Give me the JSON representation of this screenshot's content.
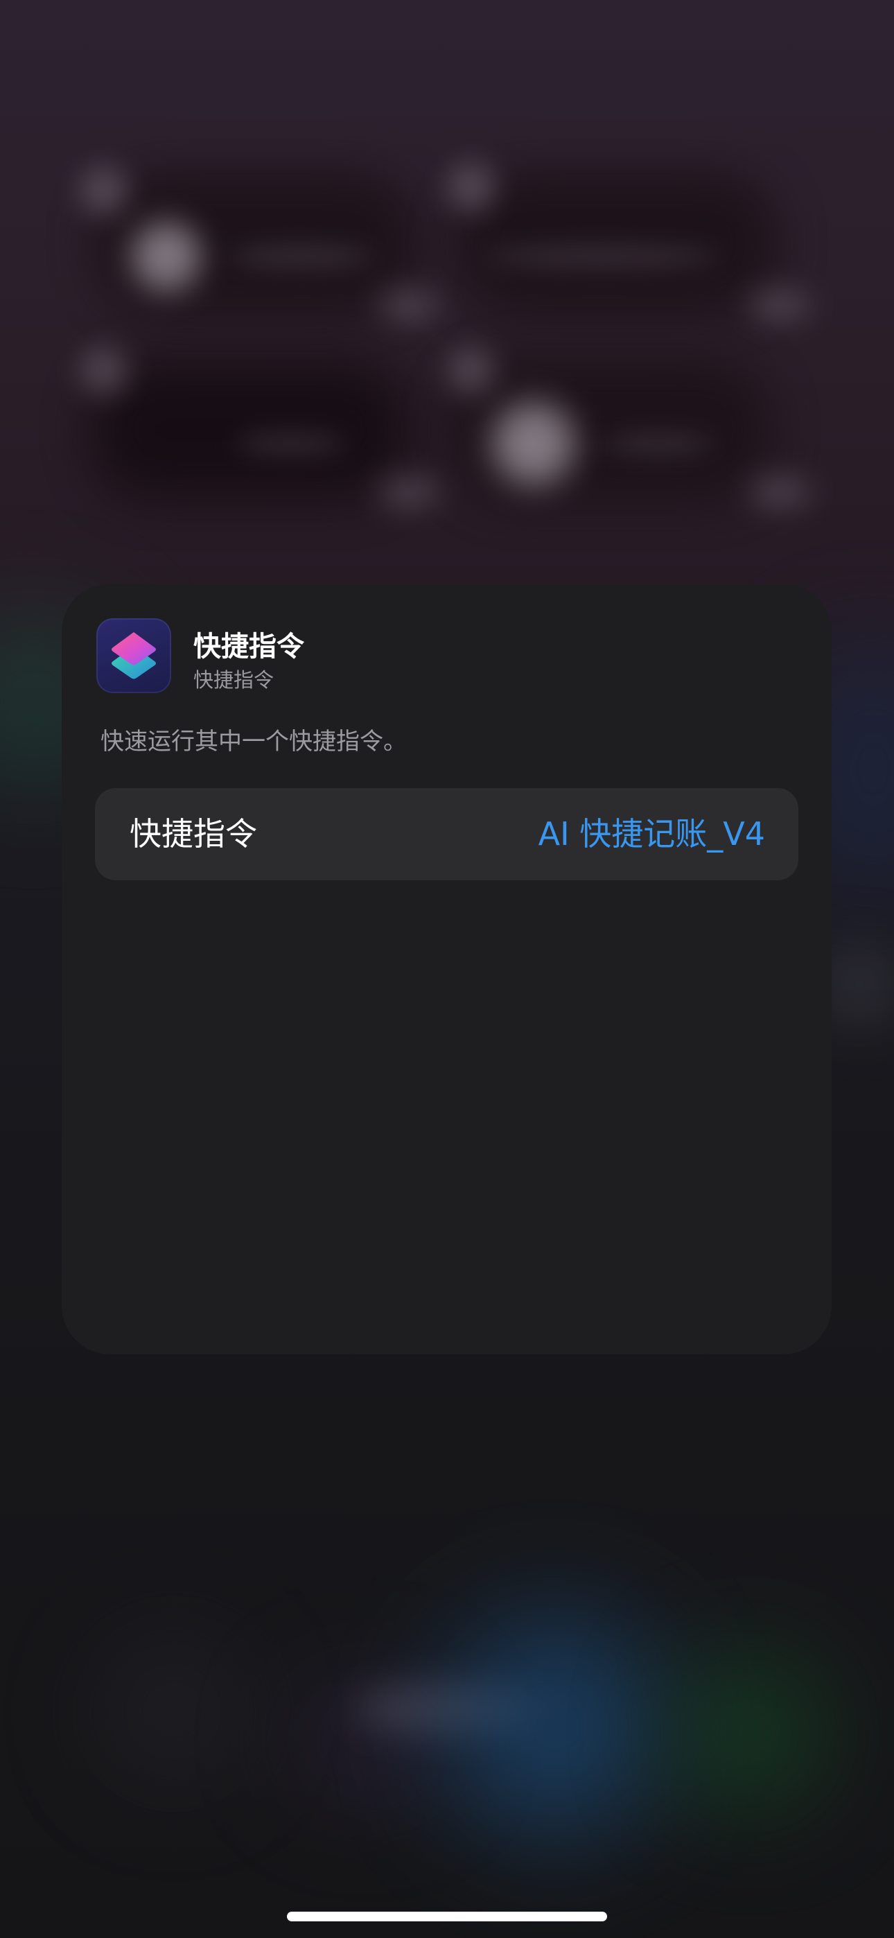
{
  "app": {
    "name": "快捷指令",
    "subtitle": "快捷指令",
    "icon": "shortcuts-app-icon"
  },
  "description": "快速运行其中一个快捷指令。",
  "parameter": {
    "label": "快捷指令",
    "value": "AI 快捷记账_V4"
  },
  "colors": {
    "card_background": "#1e1e20",
    "row_background": "#2c2c2e",
    "accent": "#3a97f0",
    "secondary_text": "#9b9ba1"
  }
}
